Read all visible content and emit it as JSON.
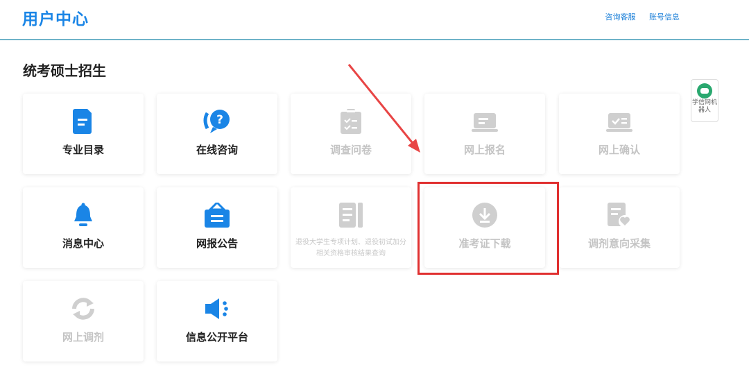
{
  "header": {
    "logo": "用户中心",
    "links": [
      "咨询客服",
      "账号信息"
    ]
  },
  "section": {
    "title": "统考硕士招生"
  },
  "cards": [
    {
      "label": "专业目录",
      "icon": "document-icon",
      "enabled": true
    },
    {
      "label": "在线咨询",
      "icon": "chat-question-icon",
      "enabled": true
    },
    {
      "label": "调查问卷",
      "icon": "clipboard-icon",
      "enabled": false
    },
    {
      "label": "网上报名",
      "icon": "laptop-icon",
      "enabled": false
    },
    {
      "label": "网上确认",
      "icon": "laptop-check-icon",
      "enabled": false
    },
    {
      "label": "消息中心",
      "icon": "bell-icon",
      "enabled": true
    },
    {
      "label": "网报公告",
      "icon": "notice-board-icon",
      "enabled": true
    },
    {
      "label": "退役大学生专项计划、退役初试加分相关资格审核结果查询",
      "icon": "list-document-icon",
      "enabled": false
    },
    {
      "label": "准考证下载",
      "icon": "download-icon",
      "enabled": false
    },
    {
      "label": "调剂意向采集",
      "icon": "document-heart-icon",
      "enabled": false
    },
    {
      "label": "网上调剂",
      "icon": "refresh-icon",
      "enabled": false
    },
    {
      "label": "信息公开平台",
      "icon": "speaker-icon",
      "enabled": true
    }
  ],
  "robot": {
    "label": "学信网机器人"
  },
  "colors": {
    "accent": "#1a85e6",
    "disabled": "#c4c4c4",
    "highlight": "#e03030"
  }
}
